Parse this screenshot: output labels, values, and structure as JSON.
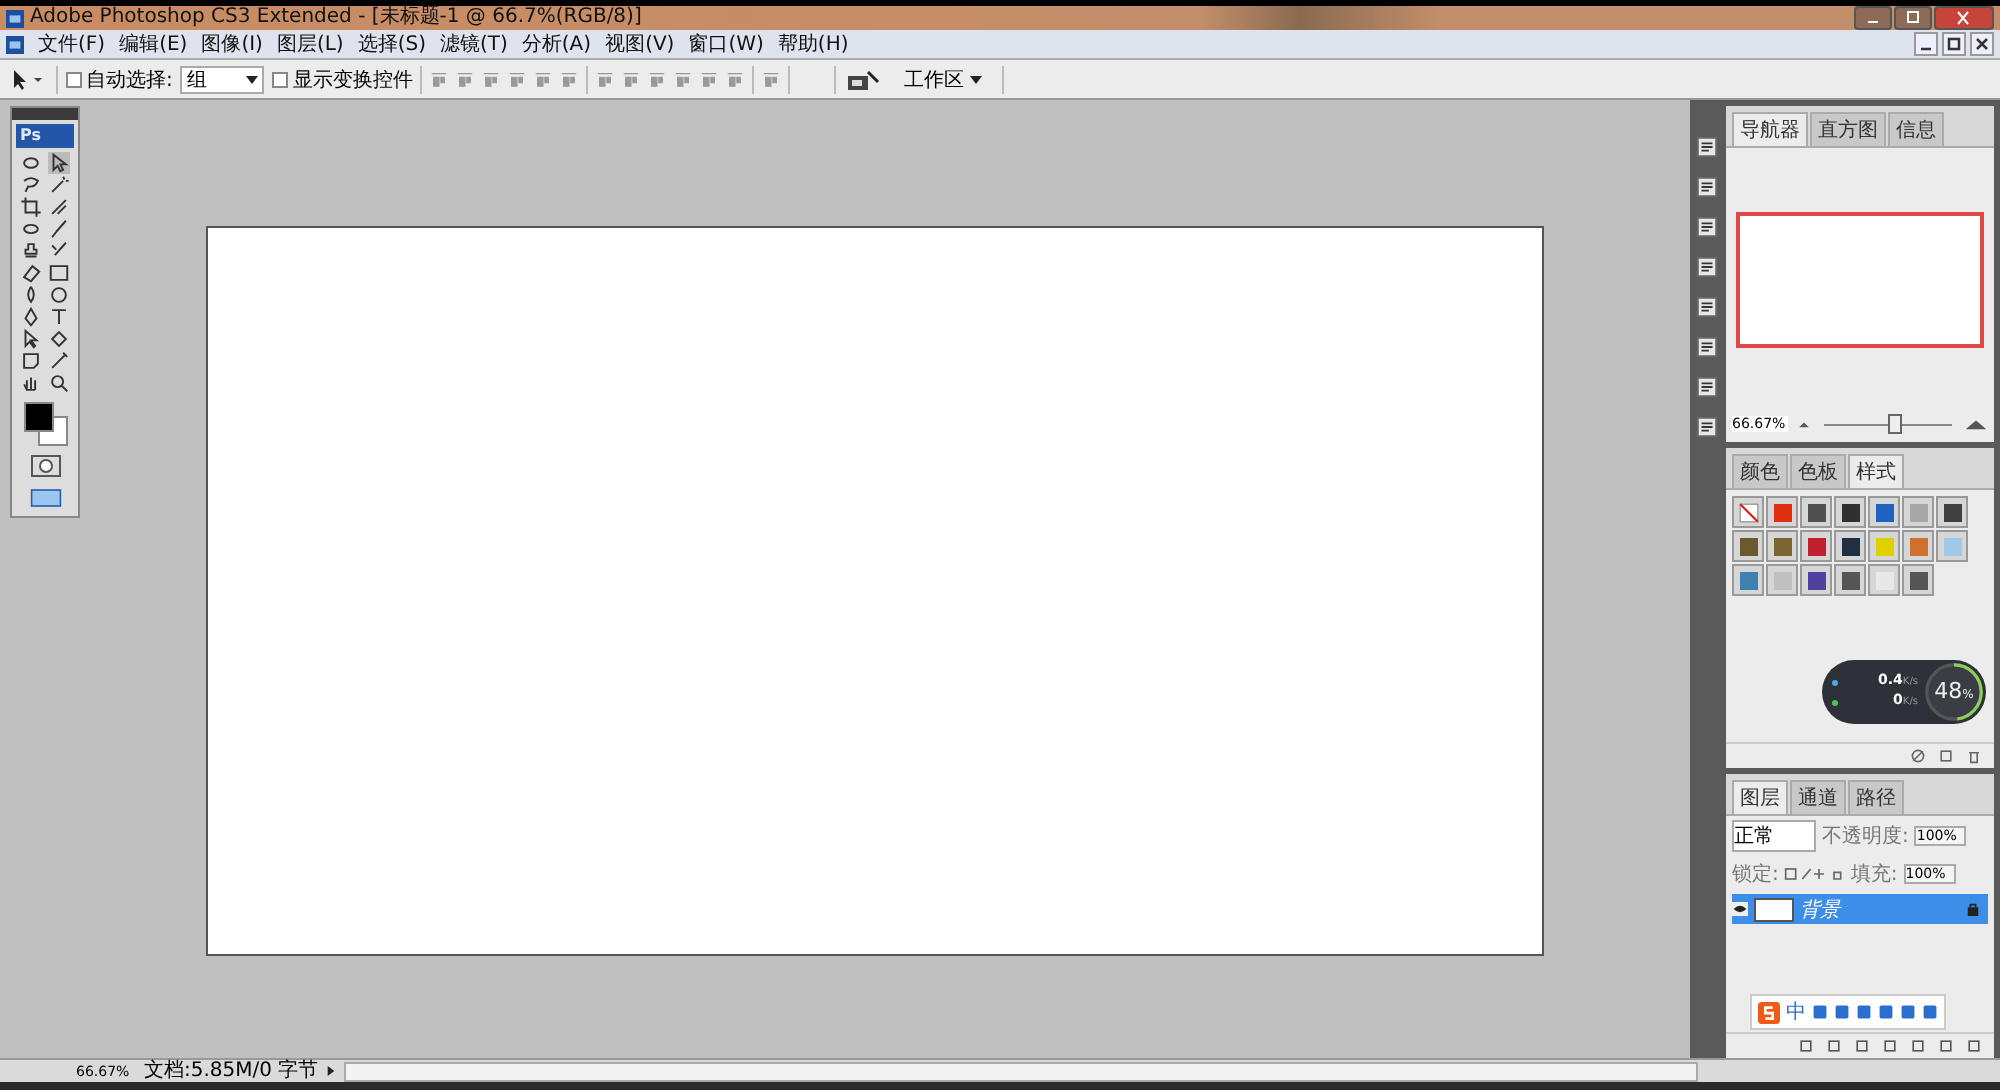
{
  "window": {
    "title": "Adobe Photoshop CS3 Extended - [未标题-1 @ 66.7%(RGB/8)]"
  },
  "menu": [
    "文件(F)",
    "编辑(E)",
    "图像(I)",
    "图层(L)",
    "选择(S)",
    "滤镜(T)",
    "分析(A)",
    "视图(V)",
    "窗口(W)",
    "帮助(H)"
  ],
  "options": {
    "auto_select": {
      "label": "自动选择:",
      "checked": false
    },
    "auto_select_target": "组",
    "show_transform": {
      "label": "显示变换控件",
      "checked": false
    },
    "workspace": "工作区"
  },
  "toolbox": {
    "logo": "Ps"
  },
  "navigator": {
    "tabs": [
      {
        "label": "导航器",
        "selected": true
      },
      {
        "label": "直方图",
        "selected": false
      },
      {
        "label": "信息",
        "selected": false
      }
    ],
    "zoom": "66.67%",
    "level": 0.55
  },
  "styles": {
    "tabs": [
      {
        "label": "颜色",
        "selected": false
      },
      {
        "label": "色板",
        "selected": false
      },
      {
        "label": "样式",
        "selected": true
      }
    ],
    "swatches": [
      {
        "kind": "none",
        "color": "#ffffff"
      },
      {
        "kind": "fill",
        "color": "#e03010"
      },
      {
        "kind": "fill",
        "color": "#505050"
      },
      {
        "kind": "fill",
        "color": "#303030"
      },
      {
        "kind": "fill",
        "color": "#2060c0"
      },
      {
        "kind": "fill",
        "color": "#a8a8a8"
      },
      {
        "kind": "fill",
        "color": "#404040"
      },
      {
        "kind": "fill",
        "color": "#6b5a30"
      },
      {
        "kind": "fill",
        "color": "#7a6530"
      },
      {
        "kind": "fill",
        "color": "#c02030"
      },
      {
        "kind": "fill",
        "color": "#203040"
      },
      {
        "kind": "fill",
        "color": "#e0d000"
      },
      {
        "kind": "fill",
        "color": "#d07030"
      },
      {
        "kind": "fill",
        "color": "#a0c8e8"
      },
      {
        "kind": "fill",
        "color": "#4080b0"
      },
      {
        "kind": "fill",
        "color": "#c0c0c0"
      },
      {
        "kind": "fill",
        "color": "#5040a0"
      },
      {
        "kind": "fill",
        "color": "#555555"
      },
      {
        "kind": "fill",
        "color": "#e8e8e8"
      },
      {
        "kind": "fill",
        "color": "#555555"
      }
    ]
  },
  "net_widget": {
    "upload": "0.4",
    "upload_unit": "K/s",
    "download": "0",
    "download_unit": "K/s",
    "percent": "48",
    "percent_unit": "%",
    "level": 0.48
  },
  "layers": {
    "tabs": [
      {
        "label": "图层",
        "selected": true
      },
      {
        "label": "通道",
        "selected": false
      },
      {
        "label": "路径",
        "selected": false
      }
    ],
    "blend_mode": "正常",
    "opacity_label": "不透明度:",
    "opacity": "100%",
    "lock_label": "锁定:",
    "fill_label": "填充:",
    "fill": "100%",
    "items": [
      {
        "name": "背景",
        "visible": true,
        "selected": true,
        "locked": true
      }
    ]
  },
  "ime": {
    "label": "中"
  },
  "status": {
    "zoom": "66.67%",
    "doc": "文档:5.85M/0 字节"
  }
}
